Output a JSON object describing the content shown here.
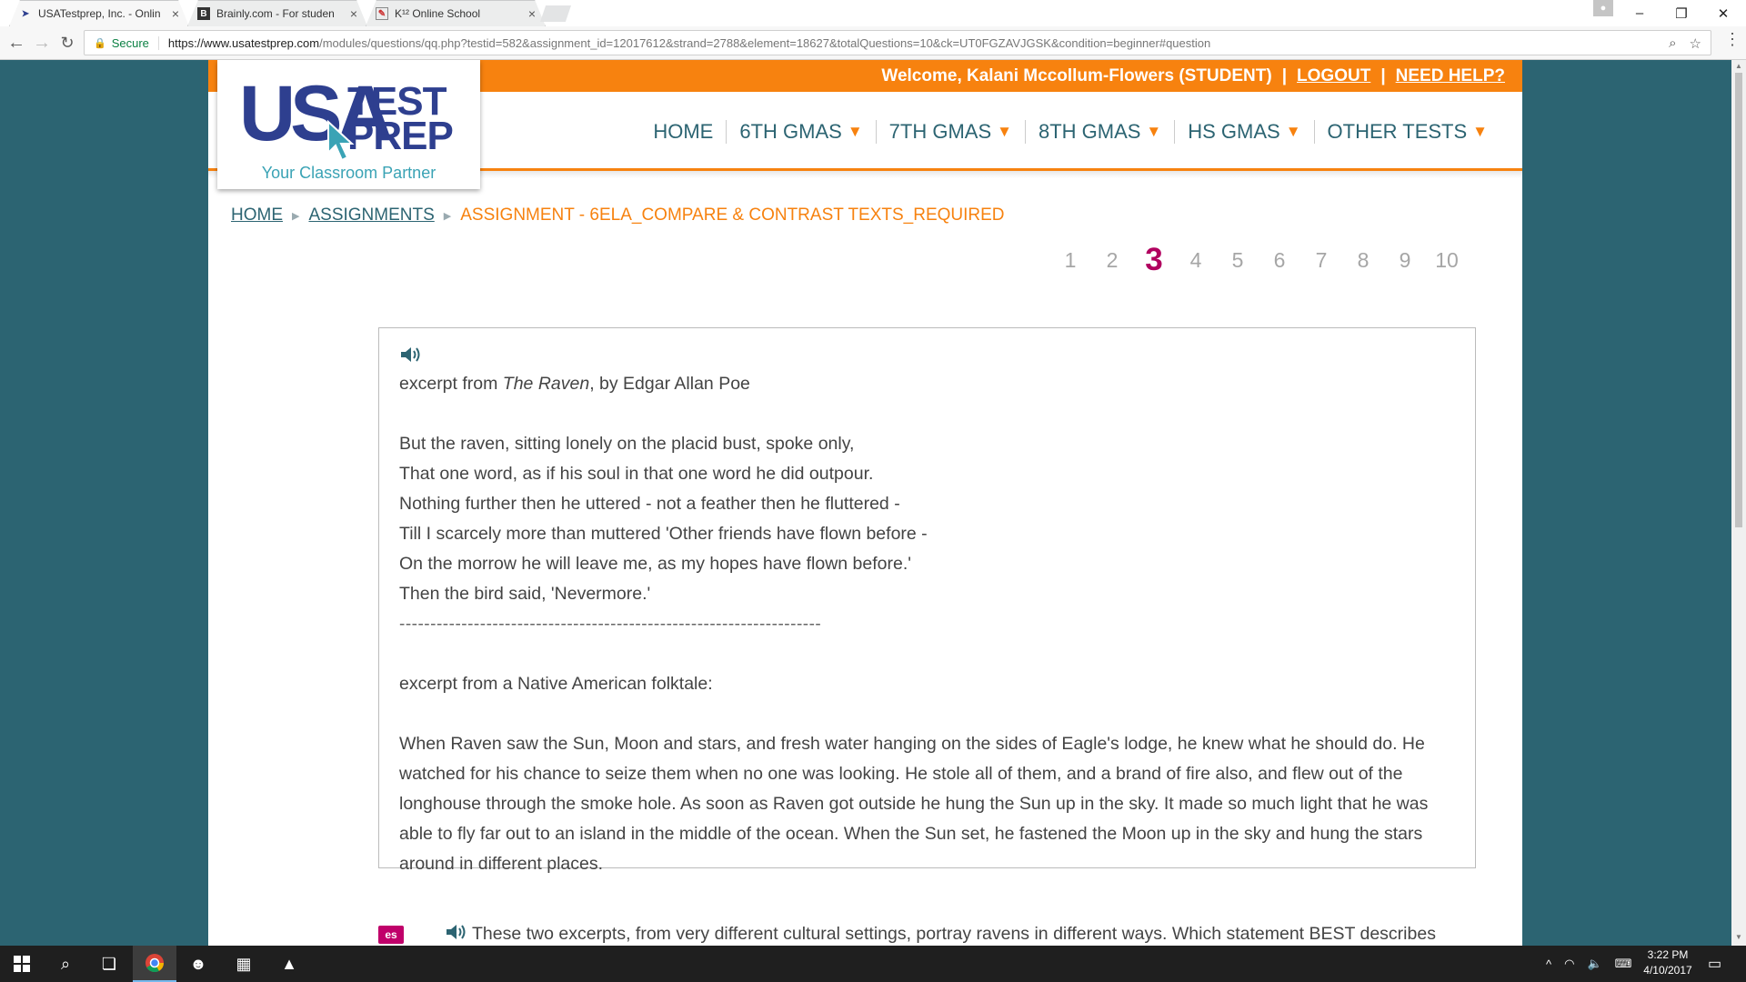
{
  "browser": {
    "tabs": [
      {
        "title": "USATestprep, Inc. - Onlin",
        "favicon": "cursor-icon",
        "active": true
      },
      {
        "title": "Brainly.com - For studen",
        "favicon": "b-icon",
        "active": false
      },
      {
        "title": "K¹² Online School",
        "favicon": "k12-icon",
        "active": false
      }
    ],
    "secure_label": "Secure",
    "url_host": "https://www.usatestprep.com",
    "url_path": "/modules/questions/qq.php?testid=582&assignment_id=12017612&strand=2788&element=18627&totalQuestions=10&ck=UT0FGZAVJGSK&condition=beginner#question"
  },
  "header": {
    "welcome": "Welcome, Kalani Mccollum-Flowers (STUDENT)",
    "sep1": "|",
    "logout": "LOGOUT",
    "sep2": "|",
    "help": "NEED HELP?"
  },
  "logo": {
    "usa": "USA",
    "test": "TEST",
    "prep": "PREP",
    "tagline": "Your Classroom Partner"
  },
  "nav": [
    {
      "label": "HOME",
      "dropdown": false
    },
    {
      "label": "6TH GMAS",
      "dropdown": true
    },
    {
      "label": "7TH GMAS",
      "dropdown": true
    },
    {
      "label": "8TH GMAS",
      "dropdown": true
    },
    {
      "label": "HS GMAS",
      "dropdown": true
    },
    {
      "label": "OTHER TESTS",
      "dropdown": true
    }
  ],
  "breadcrumb": {
    "home": "HOME",
    "assignments": "ASSIGNMENTS",
    "current": "ASSIGNMENT - 6ELA_COMPARE & CONTRAST TEXTS_REQUIRED"
  },
  "pager": {
    "pages": [
      "1",
      "2",
      "3",
      "4",
      "5",
      "6",
      "7",
      "8",
      "9",
      "10"
    ],
    "current": "3"
  },
  "passage": {
    "excerpt1_pre": "excerpt from ",
    "excerpt1_title": "The Raven",
    "excerpt1_post": ", by Edgar Allan Poe",
    "poem": [
      "But the raven, sitting lonely on the placid bust, spoke only,",
      "That one word, as if his soul in that one word he did outpour.",
      "Nothing further then he uttered - not a feather then he fluttered -",
      "Till I scarcely more than muttered 'Other friends have flown before -",
      "On the morrow he will leave me, as my hopes have flown before.'",
      "Then the bird said, 'Nevermore.'"
    ],
    "divider": "--------------------------------------------------------------------",
    "excerpt2": "excerpt from a Native American folktale:",
    "folktale": "When Raven saw the Sun, Moon and stars, and fresh water hanging on the sides of Eagle's lodge, he knew what he should do. He watched for his chance to seize them when no one was looking. He stole all of them, and a brand of fire also, and flew out of the longhouse through the smoke hole. As soon as Raven got outside he hung the Sun up in the sky. It made so much light that he was able to fly far out to an island in the middle of the ocean. When the Sun set, he fastened the Moon up in the sky and hung the stars around in different places."
  },
  "question": {
    "badge": "es",
    "text": "These two excerpts, from very different cultural settings, portray ravens in different ways. Which statement BEST describes"
  },
  "taskbar": {
    "time": "3:22 PM",
    "date": "4/10/2017"
  },
  "colors": {
    "brand_orange": "#f7820f",
    "brand_teal": "#2c6472",
    "logo_blue": "#2e3f8f",
    "current_page": "#b1005f"
  }
}
